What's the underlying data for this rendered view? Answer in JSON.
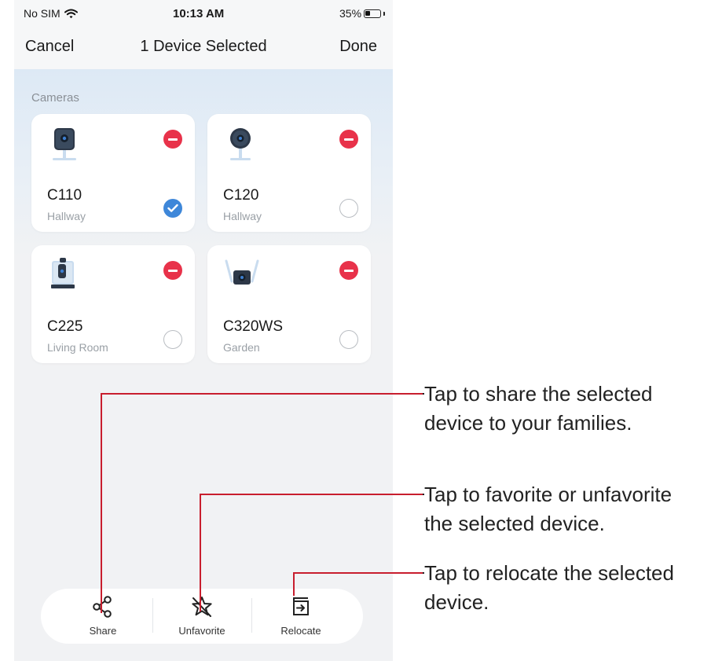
{
  "status_bar": {
    "carrier": "No SIM",
    "time": "10:13 AM",
    "battery_percent": "35%",
    "battery_level": 0.35
  },
  "nav": {
    "cancel": "Cancel",
    "title": "1 Device Selected",
    "done": "Done"
  },
  "section": {
    "label": "Cameras"
  },
  "devices": [
    {
      "name": "C110",
      "room": "Hallway",
      "selected": true
    },
    {
      "name": "C120",
      "room": "Hallway",
      "selected": false
    },
    {
      "name": "C225",
      "room": "Living Room",
      "selected": false
    },
    {
      "name": "C320WS",
      "room": "Garden",
      "selected": false
    }
  ],
  "toolbar": {
    "share": "Share",
    "unfavorite": "Unfavorite",
    "relocate": "Relocate"
  },
  "annotations": {
    "share": [
      "Tap to share the selected",
      "device to your families."
    ],
    "favorite": [
      "Tap to favorite or unfavorite",
      "the selected device."
    ],
    "relocate": [
      "Tap to relocate the selected",
      "device."
    ]
  },
  "colors": {
    "accent_red": "#c81e2e",
    "remove_red": "#e8324a",
    "check_blue": "#3e87d9"
  }
}
